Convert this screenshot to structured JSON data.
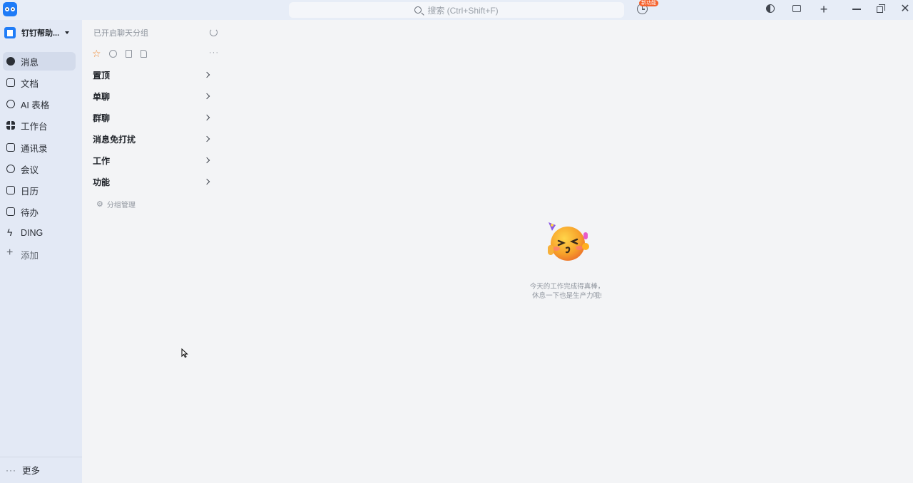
{
  "titlebar": {
    "search_placeholder": "搜索 (Ctrl+Shift+F)",
    "new_badge": "新功能"
  },
  "nav": {
    "org_name": "钉钉帮助...",
    "items": [
      {
        "label": "消息",
        "icon": "chat-icon",
        "active": true
      },
      {
        "label": "文档",
        "icon": "doc-icon"
      },
      {
        "label": "AI 表格",
        "icon": "ai-table-icon"
      },
      {
        "label": "工作台",
        "icon": "grid-icon"
      },
      {
        "label": "通讯录",
        "icon": "contacts-icon"
      },
      {
        "label": "会议",
        "icon": "meeting-icon"
      },
      {
        "label": "日历",
        "icon": "calendar-icon"
      },
      {
        "label": "待办",
        "icon": "todo-icon"
      },
      {
        "label": "DING",
        "icon": "bolt-icon"
      },
      {
        "label": "添加",
        "icon": "plus-icon"
      }
    ],
    "more_label": "更多"
  },
  "panel": {
    "header": "已开启聊天分组",
    "groups": [
      {
        "label": "置顶"
      },
      {
        "label": "单聊"
      },
      {
        "label": "群聊"
      },
      {
        "label": "消息免打扰"
      },
      {
        "label": "工作"
      },
      {
        "label": "功能"
      }
    ],
    "manage_label": "分组管理"
  },
  "main": {
    "empty_line1": "今天的工作完成得真棒，",
    "empty_line2": "休息一下也是生产力哦!"
  },
  "colors": {
    "accent": "#1f7cf7",
    "badge": "#f5612c",
    "star": "#f0862c"
  }
}
